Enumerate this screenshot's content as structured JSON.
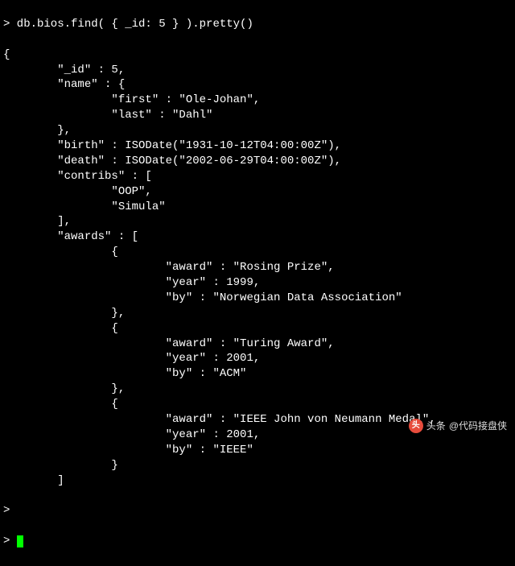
{
  "command_line": "> db.bios.find( { _id: 5 } ).pretty()",
  "output": "{\n        \"_id\" : 5,\n        \"name\" : {\n                \"first\" : \"Ole-Johan\",\n                \"last\" : \"Dahl\"\n        },\n        \"birth\" : ISODate(\"1931-10-12T04:00:00Z\"),\n        \"death\" : ISODate(\"2002-06-29T04:00:00Z\"),\n        \"contribs\" : [\n                \"OOP\",\n                \"Simula\"\n        ],\n        \"awards\" : [\n                {\n                        \"award\" : \"Rosing Prize\",\n                        \"year\" : 1999,\n                        \"by\" : \"Norwegian Data Association\"\n                },\n                {\n                        \"award\" : \"Turing Award\",\n                        \"year\" : 2001,\n                        \"by\" : \"ACM\"\n                },\n                {\n                        \"award\" : \"IEEE John von Neumann Medal\",\n                        \"year\" : 2001,\n                        \"by\" : \"IEEE\"\n                }\n        ]",
  "prompt_symbol": "> ",
  "watermark": {
    "logo_text": "头",
    "prefix": "头条",
    "handle": "@代码接盘侠"
  }
}
